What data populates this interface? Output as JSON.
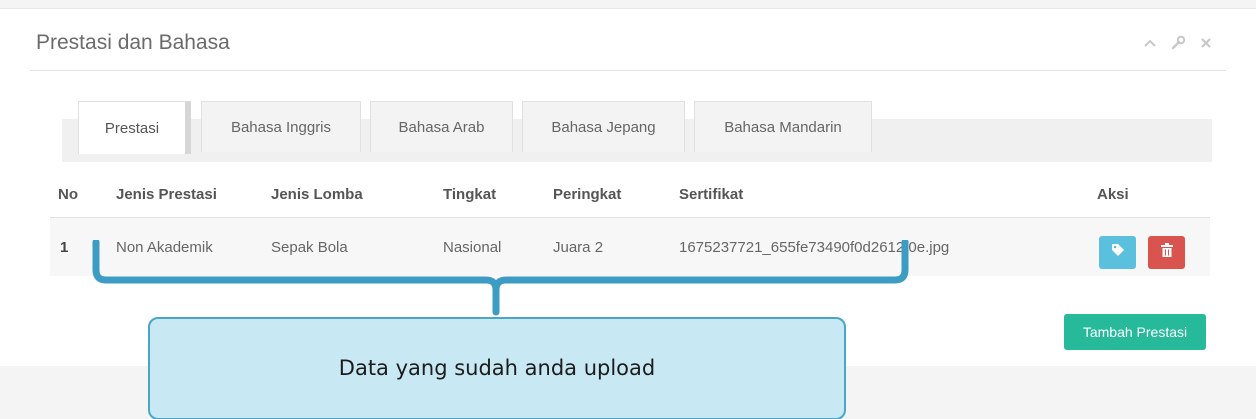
{
  "panel": {
    "title": "Prestasi dan Bahasa",
    "tools": [
      "chevron-up-icon",
      "wrench-icon",
      "close-icon"
    ]
  },
  "tabs": [
    {
      "label": "Prestasi",
      "active": true
    },
    {
      "label": "Bahasa Inggris",
      "active": false
    },
    {
      "label": "Bahasa Arab",
      "active": false
    },
    {
      "label": "Bahasa Jepang",
      "active": false
    },
    {
      "label": "Bahasa Mandarin",
      "active": false
    }
  ],
  "table": {
    "headers": {
      "no": "No",
      "jenis_prestasi": "Jenis Prestasi",
      "jenis_lomba": "Jenis Lomba",
      "tingkat": "Tingkat",
      "peringkat": "Peringkat",
      "sertifikat": "Sertifikat",
      "aksi": "Aksi"
    },
    "rows": [
      {
        "no": "1",
        "jenis_prestasi": "Non Akademik",
        "jenis_lomba": "Sepak Bola",
        "tingkat": "Nasional",
        "peringkat": "Juara 2",
        "sertifikat": "1675237721_655fe73490f0d2612f0e.jpg"
      }
    ]
  },
  "actions": {
    "add_label": "Tambah Prestasi"
  },
  "callout": {
    "text": "Data yang sudah anda upload"
  },
  "colors": {
    "info": "#5bc0de",
    "danger": "#d9534f",
    "success": "#26b99a",
    "callout_fill": "#c8e8f3",
    "callout_border": "#4aa6c9"
  }
}
